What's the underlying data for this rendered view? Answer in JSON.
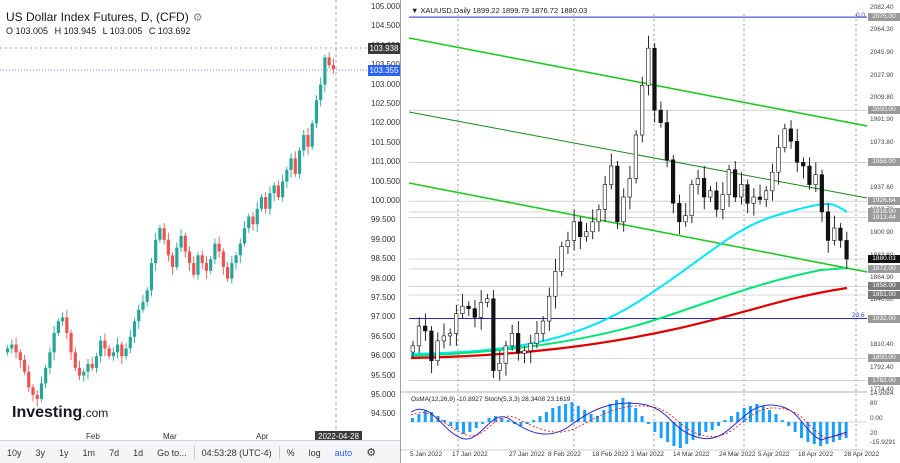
{
  "left": {
    "title": "US Dollar Index Futures, D, (CFD)",
    "ohlc": {
      "o": "O 103.005",
      "h": "H 103.945",
      "l": "L 103.005",
      "c": "C 103.692"
    },
    "price_axis": [
      "105.000",
      "104.500",
      "104.000",
      "103.500",
      "103.000",
      "102.500",
      "102.000",
      "101.500",
      "101.000",
      "100.500",
      "100.000",
      "99.500",
      "99.000",
      "98.500",
      "98.000",
      "97.500",
      "97.000",
      "96.500",
      "96.000",
      "95.500",
      "95.000",
      "94.500"
    ],
    "price_tags": {
      "high": "103.938",
      "last": "103.355",
      "near": "103.500"
    },
    "time_axis": [
      "Feb",
      "Mar",
      "Apr"
    ],
    "date_tag": "2022-04-28",
    "logo": "Investing",
    "logo_suffix": ".com",
    "toolbar": {
      "r10y": "10y",
      "r3y": "3y",
      "r1y": "1y",
      "r1m": "1m",
      "r7d": "7d",
      "r1d": "1d",
      "goto": "Go to...",
      "time": "04:53:28 (UTC-4)",
      "pct": "%",
      "log": "log",
      "auto": "auto"
    },
    "colors": {
      "up": "#26a69a",
      "down": "#ef5350",
      "blue_tag": "#2962ff"
    }
  },
  "right": {
    "header": "XAUUSD,Daily  1899.22 1899.79 1876.72 1880.03",
    "price_axis": [
      "2082.40",
      "2064.30",
      "2045.90",
      "2027.90",
      "2009.80",
      "1991.90",
      "1973.80",
      "1955.80",
      "1937.60",
      "1919.70",
      "1900.90",
      "1882.80",
      "1864.90",
      "1846.80",
      "1828.90",
      "1810.40",
      "1792.40",
      "1774.40"
    ],
    "level_tags": [
      "2075.00",
      "2000.00",
      "1958.00",
      "1926.64",
      "1918.00",
      "1913.44",
      "1880.03",
      "1872.00",
      "1858.00",
      "1851.00",
      "1832.00",
      "1800.00",
      "1782.00"
    ],
    "fib_labels": {
      "top": "0.0",
      "bottom": "23.6"
    },
    "time_axis": [
      "5 Jan 2022",
      "17 Jan 2022",
      "27 Jan 2022",
      "8 Feb 2022",
      "18 Feb 2022",
      "2 Mar 2022",
      "14 Mar 2022",
      "24 Mar 2022",
      "5 Apr 2022",
      "18 Apr 2022",
      "28 Apr 2022"
    ],
    "oscillator": {
      "label": "OsMA(12,26,9) -10.8927  Stoch(5,3,3) 28.3408 23.1619",
      "axis": [
        "14.9084",
        "80",
        "0.00",
        "20",
        "-15.9291"
      ]
    },
    "colors": {
      "candle": "#111111",
      "ma_cyan": "#00e5ff",
      "ma_green": "#00e676",
      "ma_red": "#e00000",
      "channel": "#22c922",
      "hist": "#1aa0ff"
    }
  }
}
